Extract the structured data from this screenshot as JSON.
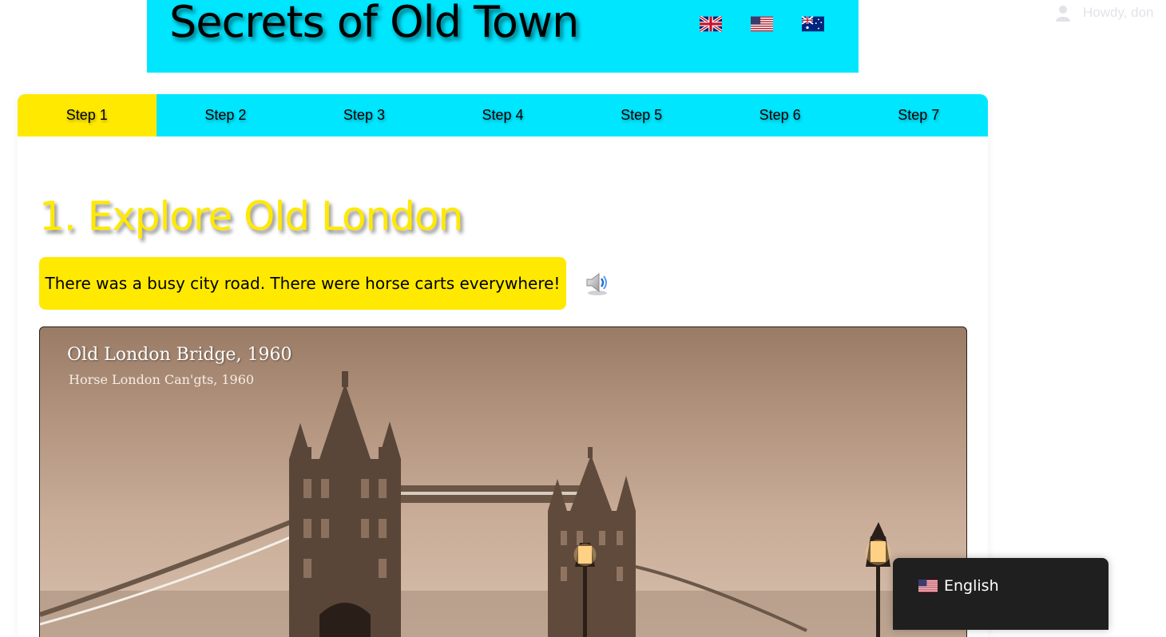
{
  "header": {
    "title": "Secrets of Old Town",
    "background_color": "#00e6ff",
    "flags": [
      {
        "name": "uk-flag-icon"
      },
      {
        "name": "us-flag-icon"
      },
      {
        "name": "australia-flag-icon"
      }
    ]
  },
  "admin_bar": {
    "greeting": "Howdy, don"
  },
  "tabs": [
    {
      "label": "Step 1",
      "active": true
    },
    {
      "label": "Step 2",
      "active": false
    },
    {
      "label": "Step 3",
      "active": false
    },
    {
      "label": "Step 4",
      "active": false
    },
    {
      "label": "Step 5",
      "active": false
    },
    {
      "label": "Step 6",
      "active": false
    },
    {
      "label": "Step 7",
      "active": false
    }
  ],
  "step": {
    "heading": "1. Explore Old London",
    "caption": "There was a busy city road. There were horse carts everywhere!",
    "audio_icon": "speaker-icon"
  },
  "photo": {
    "title_main": "Old London Bridge",
    "title_year": ", 1960",
    "subtitle": "Horse London Can'gts, 1960"
  },
  "language_switcher": {
    "current_language": "English",
    "flag": "us-flag-icon"
  },
  "colors": {
    "accent_cyan": "#00e6ff",
    "accent_yellow": "#ffe900",
    "switcher_bg": "#1f1f1f"
  }
}
